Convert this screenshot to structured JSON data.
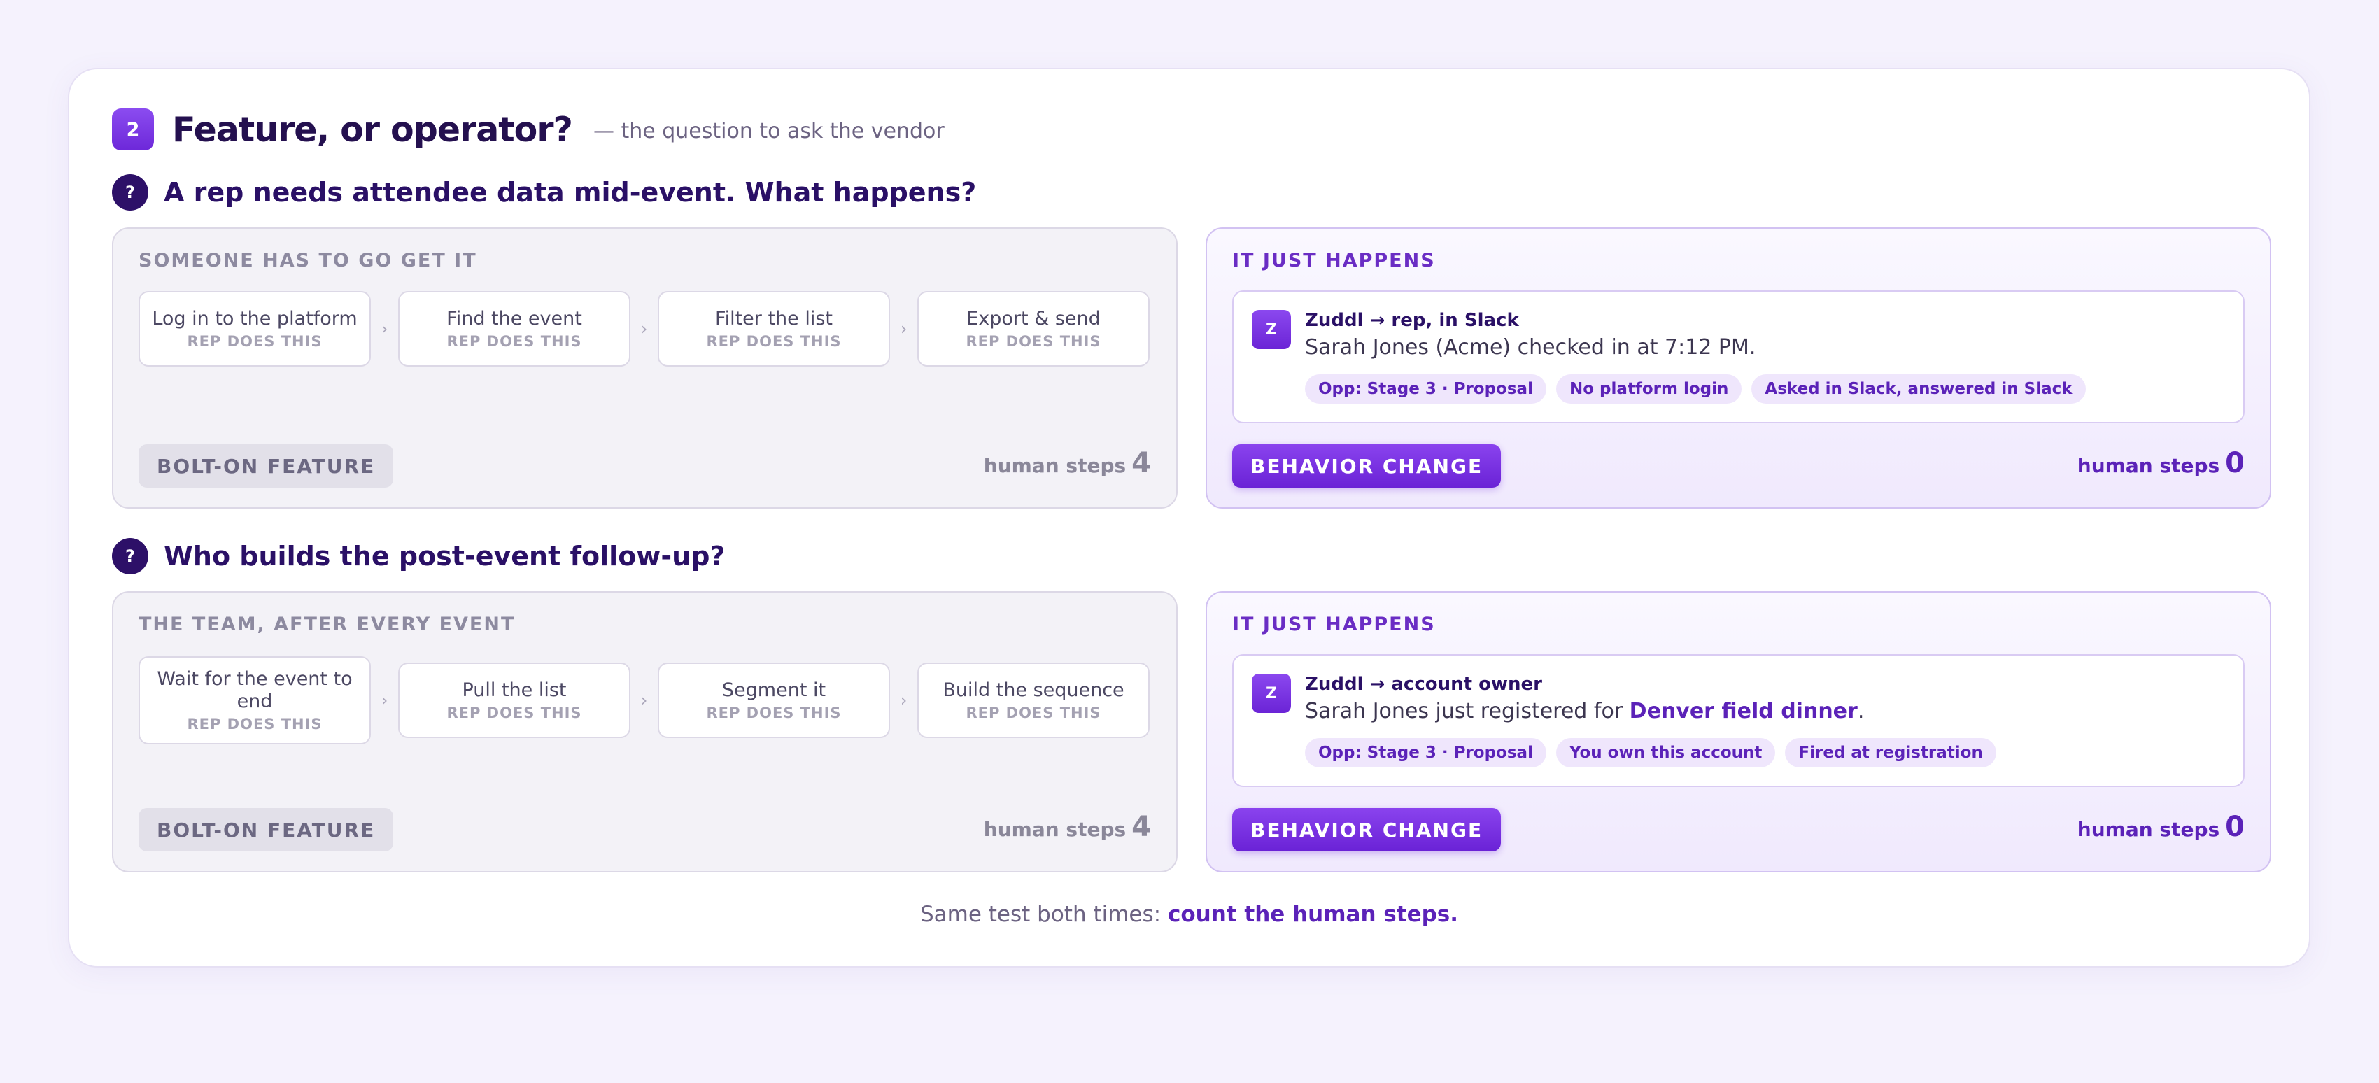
{
  "header": {
    "number": "2",
    "title": "Feature, or operator?",
    "subtitle": "— the question to ask the vendor"
  },
  "sections": [
    {
      "question": "A rep needs attendee data mid-event. What happens?",
      "left": {
        "label": "SOMEONE HAS TO GO GET IT",
        "steps": [
          {
            "title": "Log in to the platform",
            "actor": "REP DOES THIS"
          },
          {
            "title": "Find the event",
            "actor": "REP DOES THIS"
          },
          {
            "title": "Filter the list",
            "actor": "REP DOES THIS"
          },
          {
            "title": "Export & send",
            "actor": "REP DOES THIS"
          }
        ],
        "tag": "BOLT-ON FEATURE",
        "steps_label": "human steps",
        "steps_count": "4"
      },
      "right": {
        "label": "IT JUST HAPPENS",
        "avatar": "Z",
        "from": "Zuddl → rep, in Slack",
        "text_before": "Sarah Jones (Acme) checked in at 7:12 PM.",
        "text_highlight": "",
        "text_after": "",
        "chips": [
          "Opp: Stage 3 · Proposal",
          "No platform login",
          "Asked in Slack, answered in Slack"
        ],
        "tag": "BEHAVIOR CHANGE",
        "steps_label": "human steps",
        "steps_count": "0"
      }
    },
    {
      "question": "Who builds the post-event follow-up?",
      "left": {
        "label": "THE TEAM, AFTER EVERY EVENT",
        "steps": [
          {
            "title": "Wait for the event to end",
            "actor": "REP DOES THIS"
          },
          {
            "title": "Pull the list",
            "actor": "REP DOES THIS"
          },
          {
            "title": "Segment it",
            "actor": "REP DOES THIS"
          },
          {
            "title": "Build the sequence",
            "actor": "REP DOES THIS"
          }
        ],
        "tag": "BOLT-ON FEATURE",
        "steps_label": "human steps",
        "steps_count": "4"
      },
      "right": {
        "label": "IT JUST HAPPENS",
        "avatar": "Z",
        "from": "Zuddl → account owner",
        "text_before": "Sarah Jones just registered for ",
        "text_highlight": "Denver field dinner",
        "text_after": ".",
        "chips": [
          "Opp: Stage 3 · Proposal",
          "You own this account",
          "Fired at registration"
        ],
        "tag": "BEHAVIOR CHANGE",
        "steps_label": "human steps",
        "steps_count": "0"
      }
    }
  ],
  "footer": {
    "text": "Same test both times: ",
    "highlight": "count the human steps."
  }
}
